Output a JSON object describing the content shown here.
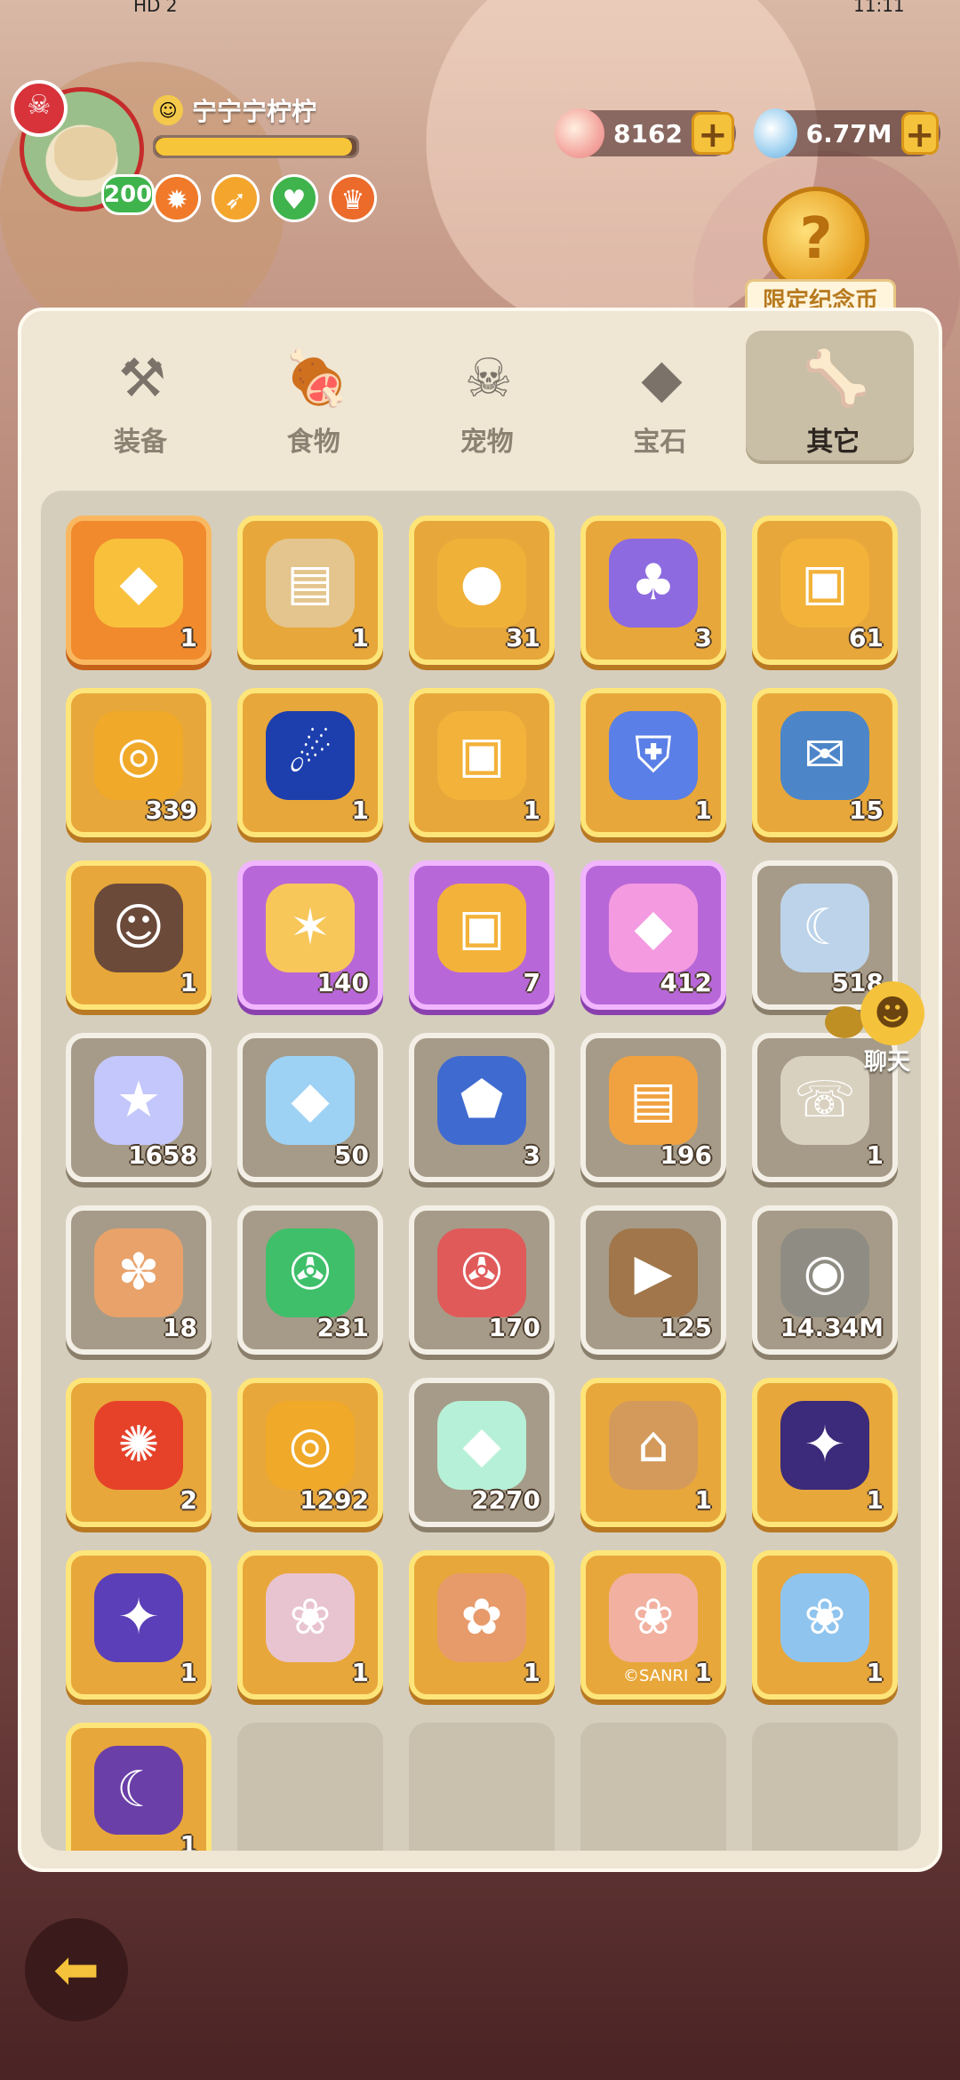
{
  "statusbar": {
    "left": "HD 2",
    "right": "11:11"
  },
  "player": {
    "name": "宁宁宁柠柠",
    "level": "200",
    "exp_fraction": 0.98,
    "badges": [
      {
        "icon": "sun-icon",
        "color": "#f07a2a",
        "glyph": "✹"
      },
      {
        "icon": "sprint-icon",
        "color": "#f4a52c",
        "glyph": "➶"
      },
      {
        "icon": "heart-icon",
        "color": "#3fb34c",
        "glyph": "♥"
      },
      {
        "icon": "trophy-icon",
        "color": "#ec6a2a",
        "glyph": "♛"
      }
    ]
  },
  "currency": {
    "shells": "8162",
    "gems": "6.77M"
  },
  "limited": {
    "label": "限定纪念币"
  },
  "tabs": [
    {
      "label": "装备",
      "icon": "hammer-icon",
      "glyph": "⚒",
      "active": false
    },
    {
      "label": "食物",
      "icon": "meat-icon",
      "glyph": "🍖",
      "active": false
    },
    {
      "label": "宠物",
      "icon": "fossil-icon",
      "glyph": "☠",
      "active": false
    },
    {
      "label": "宝石",
      "icon": "gem-icon",
      "glyph": "◆",
      "active": false
    },
    {
      "label": "其它",
      "icon": "bone-icon",
      "glyph": "🦴",
      "active": true
    }
  ],
  "items": [
    {
      "rarity": "orange",
      "icon": "chick-crystal-icon",
      "glyph": "◆",
      "color": "#f9c03c",
      "qty": "1"
    },
    {
      "rarity": "gold",
      "icon": "card-swap-icon",
      "glyph": "▤",
      "color": "#e3c58d",
      "qty": "1"
    },
    {
      "rarity": "gold",
      "icon": "cake-coin-icon",
      "glyph": "●",
      "color": "#f0b138",
      "qty": "31"
    },
    {
      "rarity": "gold",
      "icon": "bunny-bag-icon",
      "glyph": "♣",
      "color": "#8d6ae0",
      "qty": "3"
    },
    {
      "rarity": "gold",
      "icon": "horned-chest-icon",
      "glyph": "▣",
      "color": "#f3b23a",
      "qty": "61"
    },
    {
      "rarity": "gold",
      "icon": "spiral-coin-icon",
      "glyph": "◎",
      "color": "#f0a928",
      "qty": "339"
    },
    {
      "rarity": "gold",
      "icon": "runner-orb-icon",
      "glyph": "☄",
      "color": "#1d3fae",
      "qty": "1"
    },
    {
      "rarity": "gold",
      "icon": "horned-chest-icon",
      "glyph": "▣",
      "color": "#f3b23a",
      "qty": "1"
    },
    {
      "rarity": "gold",
      "icon": "paw-shield-icon",
      "glyph": "⛨",
      "color": "#5a7fe6",
      "qty": "1"
    },
    {
      "rarity": "gold",
      "icon": "blue-ticket-icon",
      "glyph": "✉",
      "color": "#4c86c9",
      "qty": "15"
    },
    {
      "rarity": "gold",
      "icon": "caveman-portrait-icon",
      "glyph": "☺",
      "color": "#6b4a3a",
      "qty": "1"
    },
    {
      "rarity": "purple",
      "icon": "star-bones-icon",
      "glyph": "✶",
      "color": "#f7c75a",
      "qty": "140"
    },
    {
      "rarity": "purple",
      "icon": "horned-chest-icon",
      "glyph": "▣",
      "color": "#f3b23a",
      "qty": "7"
    },
    {
      "rarity": "purple",
      "icon": "pink-crystal-icon",
      "glyph": "◆",
      "color": "#f49ae0",
      "qty": "412"
    },
    {
      "rarity": "white",
      "icon": "moon-shard-icon",
      "glyph": "☾",
      "color": "#bcd3ea",
      "qty": "518"
    },
    {
      "rarity": "white",
      "icon": "star-crystal-icon",
      "glyph": "★",
      "color": "#c4c7fb",
      "qty": "1658"
    },
    {
      "rarity": "white",
      "icon": "blue-gem-icon",
      "glyph": "◆",
      "color": "#9ed2f5",
      "qty": "50"
    },
    {
      "rarity": "white",
      "icon": "rune-stone-icon",
      "glyph": "⬟",
      "color": "#3f6bd0",
      "qty": "3"
    },
    {
      "rarity": "white",
      "icon": "scroll-map-icon",
      "glyph": "▤",
      "color": "#f0a240",
      "qty": "196"
    },
    {
      "rarity": "white",
      "icon": "chat-tablet-icon",
      "glyph": "☏",
      "color": "#d9d1bf",
      "qty": "1"
    },
    {
      "rarity": "white",
      "icon": "paw-ticket-icon",
      "glyph": "✽",
      "color": "#e8a26a",
      "qty": "18"
    },
    {
      "rarity": "white",
      "icon": "green-ticket-icon",
      "glyph": "✇",
      "color": "#3fbf6a",
      "qty": "231"
    },
    {
      "rarity": "white",
      "icon": "red-ticket-icon",
      "glyph": "✇",
      "color": "#e05a5a",
      "qty": "170"
    },
    {
      "rarity": "white",
      "icon": "play-ticket-icon",
      "glyph": "▶",
      "color": "#a0764a",
      "qty": "125"
    },
    {
      "rarity": "white",
      "icon": "swirl-stone-icon",
      "glyph": "◉",
      "color": "#8f8c83",
      "qty": "14.34M"
    },
    {
      "rarity": "gold",
      "icon": "fire-orb-icon",
      "glyph": "✺",
      "color": "#e6422a",
      "qty": "2"
    },
    {
      "rarity": "gold",
      "icon": "tower-coin-icon",
      "glyph": "◎",
      "color": "#f0a928",
      "qty": "1292"
    },
    {
      "rarity": "white",
      "icon": "rainbow-crystal-icon",
      "glyph": "◆",
      "color": "#b7f0d8",
      "qty": "2270"
    },
    {
      "rarity": "gold",
      "icon": "desert-diorama-icon",
      "glyph": "⌂",
      "color": "#d49a5c",
      "qty": "1"
    },
    {
      "rarity": "gold",
      "icon": "space-poster-icon",
      "glyph": "✦",
      "color": "#3c2b7a",
      "qty": "1"
    },
    {
      "rarity": "gold",
      "icon": "purple-photo-icon",
      "glyph": "✦",
      "color": "#5a3fb8",
      "qty": "1"
    },
    {
      "rarity": "gold",
      "icon": "pig-photo-icon",
      "glyph": "❀",
      "color": "#e8c4d0",
      "qty": "1"
    },
    {
      "rarity": "gold",
      "icon": "stamp-photo-icon",
      "glyph": "✿",
      "color": "#e79a6a",
      "qty": "1"
    },
    {
      "rarity": "gold",
      "icon": "sanrio-photo-icon",
      "glyph": "❀",
      "color": "#f1b0a0",
      "qty": "1",
      "watermark": "©SANRI"
    },
    {
      "rarity": "gold",
      "icon": "party-photo-icon",
      "glyph": "❀",
      "color": "#8fc4ee",
      "qty": "1"
    },
    {
      "rarity": "gold",
      "icon": "halloween-diorama-icon",
      "glyph": "☾",
      "color": "#6a3fa8",
      "qty": "1"
    },
    {
      "rarity": "empty"
    },
    {
      "rarity": "empty"
    },
    {
      "rarity": "empty"
    },
    {
      "rarity": "empty"
    }
  ],
  "chat": {
    "label": "聊天"
  },
  "colors": {
    "gold": "#e8a73a",
    "purple": "#b867d8",
    "orange": "#f08a2c",
    "white_frame": "#f4efe6"
  }
}
